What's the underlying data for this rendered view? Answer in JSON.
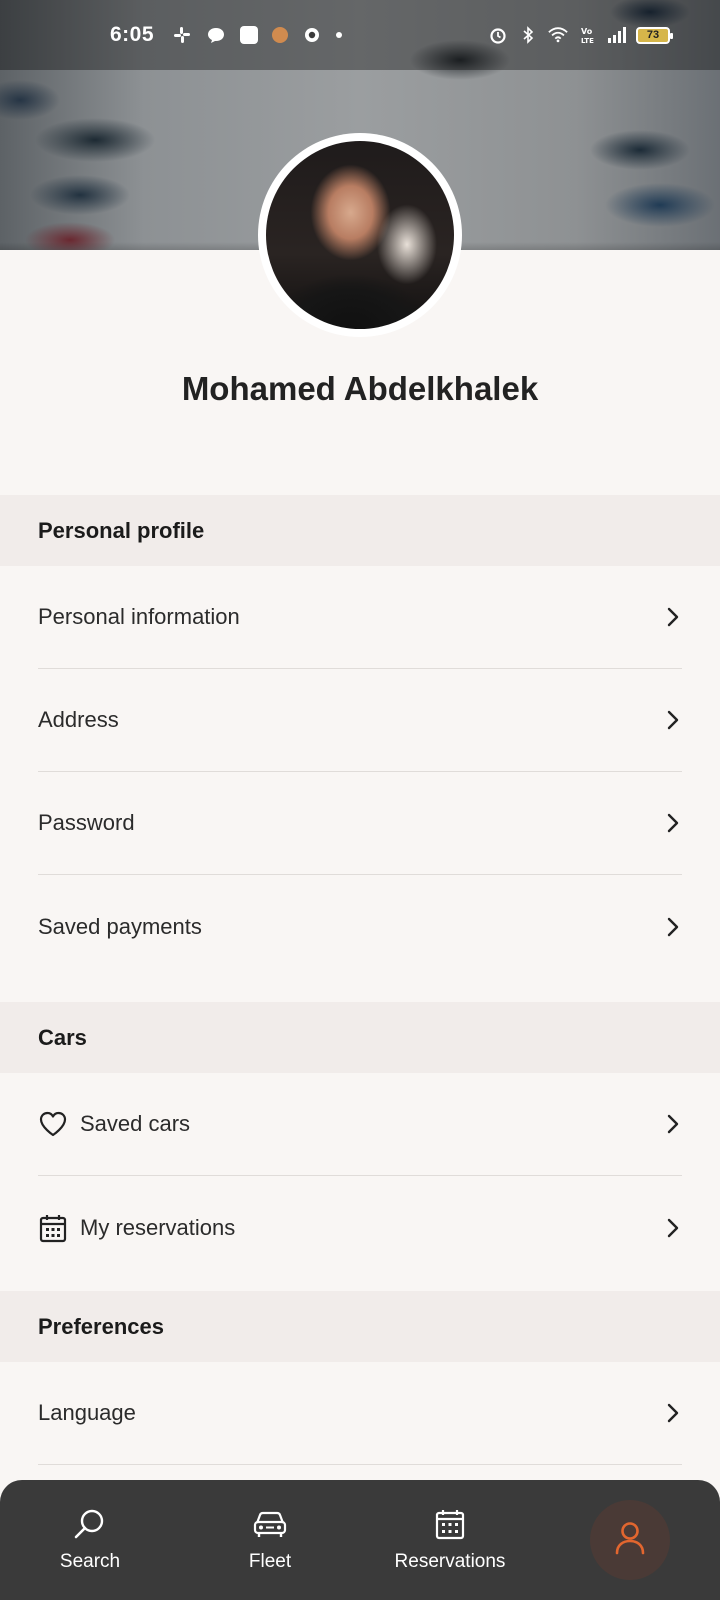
{
  "status_bar": {
    "time": "6:05",
    "battery": "73",
    "left_icons": [
      "slack-icon",
      "chat-icon",
      "app-square-icon",
      "cookie-icon",
      "github-icon",
      "dot-icon"
    ],
    "right_icons": [
      "alarm-icon",
      "bluetooth-icon",
      "wifi-icon",
      "volte-icon",
      "signal-icon",
      "battery-icon"
    ]
  },
  "profile": {
    "name": "Mohamed Abdelkhalek"
  },
  "sections": {
    "personal": {
      "title": "Personal profile",
      "items": [
        {
          "label": "Personal information"
        },
        {
          "label": "Address"
        },
        {
          "label": "Password"
        },
        {
          "label": "Saved payments"
        }
      ]
    },
    "cars": {
      "title": "Cars",
      "items": [
        {
          "label": "Saved cars",
          "icon": "heart-icon"
        },
        {
          "label": "My reservations",
          "icon": "calendar-icon"
        }
      ]
    },
    "preferences": {
      "title": "Preferences",
      "items": [
        {
          "label": "Language"
        }
      ]
    }
  },
  "bottom_nav": {
    "items": [
      {
        "label": "Search",
        "icon": "search-icon"
      },
      {
        "label": "Fleet",
        "icon": "car-icon"
      },
      {
        "label": "Reservations",
        "icon": "calendar-icon"
      }
    ],
    "active": {
      "label": "Profile",
      "icon": "person-icon"
    },
    "accent_color": "#e2662f"
  }
}
